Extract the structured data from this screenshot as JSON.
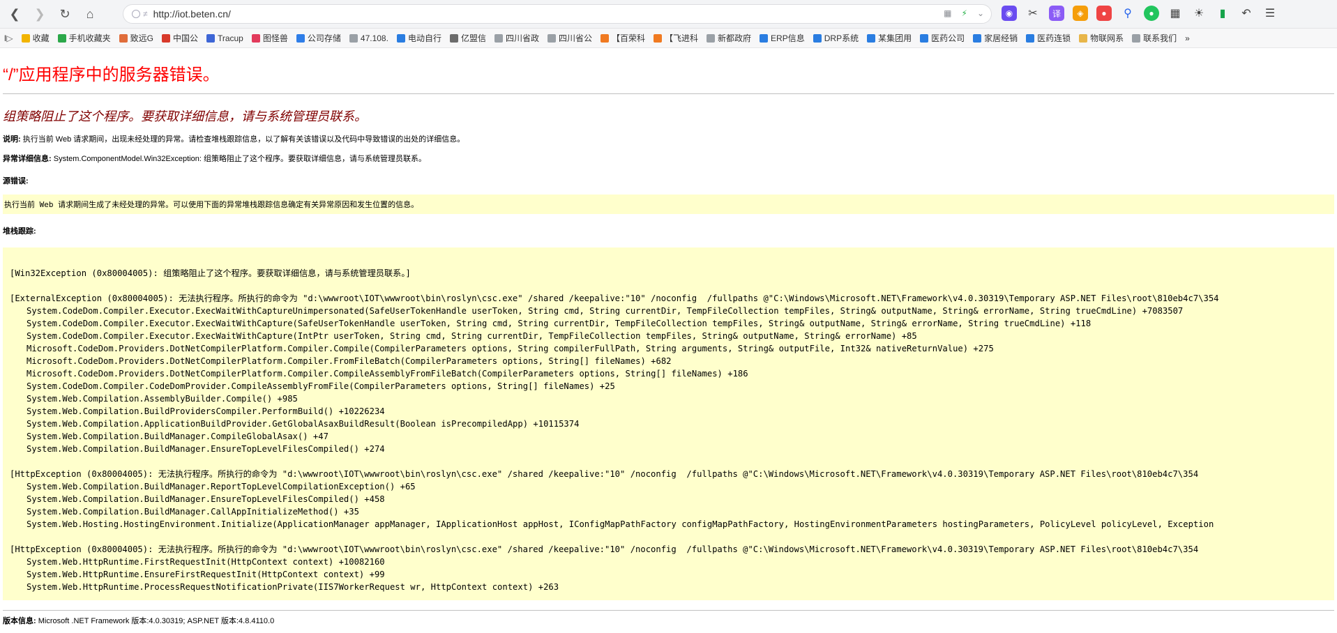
{
  "browser": {
    "url_scheme": "http://",
    "url_host": "iot.beten.cn/",
    "bookmarks": [
      {
        "label": "收藏",
        "color": "#f2b400"
      },
      {
        "label": "手机收藏夹",
        "color": "#2ca84a"
      },
      {
        "label": "致远G",
        "color": "#e06d3b"
      },
      {
        "label": "中国公",
        "color": "#d83a2b"
      },
      {
        "label": "Tracup",
        "color": "#3e66d6"
      },
      {
        "label": "图怪兽",
        "color": "#e23b5c"
      },
      {
        "label": "公司存储",
        "color": "#2f7ee8"
      },
      {
        "label": "47.108.",
        "color": "#9aa0a6"
      },
      {
        "label": "电动自行",
        "color": "#2a7de1"
      },
      {
        "label": "亿盟信",
        "color": "#6c6c6c"
      },
      {
        "label": "四川省政",
        "color": "#9aa0a6"
      },
      {
        "label": "四川省公",
        "color": "#9aa0a6"
      },
      {
        "label": "【百荣科",
        "color": "#f07a21"
      },
      {
        "label": "【飞进科",
        "color": "#f07a21"
      },
      {
        "label": "新都政府",
        "color": "#9aa0a6"
      },
      {
        "label": "ERP信息",
        "color": "#2a7de1"
      },
      {
        "label": "DRP系统",
        "color": "#2a7de1"
      },
      {
        "label": "某集团用",
        "color": "#2a7de1"
      },
      {
        "label": "医药公司",
        "color": "#2a7de1"
      },
      {
        "label": "家居经销",
        "color": "#2a7de1"
      },
      {
        "label": "医药连锁",
        "color": "#2a7de1"
      },
      {
        "label": "物联网系",
        "color": "#e8b64a"
      },
      {
        "label": "联系我们",
        "color": "#9aa0a6"
      }
    ],
    "more_label": "»"
  },
  "page": {
    "title": "“/”应用程序中的服务器错误。",
    "subtitle": "组策略阻止了这个程序。要获取详细信息，请与系统管理员联系。",
    "desc_label": "说明:",
    "desc_text": " 执行当前 Web 请求期间，出现未经处理的异常。请检查堆栈跟踪信息，以了解有关该错误以及代码中导致错误的出处的详细信息。",
    "exception_label": "异常详细信息:",
    "exception_text": " System.ComponentModel.Win32Exception: 组策略阻止了这个程序。要获取详细信息，请与系统管理员联系。",
    "source_label": "源错误:",
    "source_text": "执行当前 Web 请求期间生成了未经处理的异常。可以使用下面的异常堆栈跟踪信息确定有关异常原因和发生位置的信息。",
    "stack_label": "堆栈跟踪:",
    "stack_lines": [
      {
        "text": "[Win32Exception (0x80004005): 组策略阻止了这个程序。要获取详细信息，请与系统管理员联系。]",
        "indent": false,
        "gap": true
      },
      {
        "text": "[ExternalException (0x80004005): 无法执行程序。所执行的命令为 \"d:\\wwwroot\\IOT\\wwwroot\\bin\\roslyn\\csc.exe\" /shared /keepalive:\"10\" /noconfig  /fullpaths @\"C:\\Windows\\Microsoft.NET\\Framework\\v4.0.30319\\Temporary ASP.NET Files\\root\\810eb4c7\\354",
        "indent": false,
        "gap": true
      },
      {
        "text": "System.CodeDom.Compiler.Executor.ExecWaitWithCaptureUnimpersonated(SafeUserTokenHandle userToken, String cmd, String currentDir, TempFileCollection tempFiles, String& outputName, String& errorName, String trueCmdLine) +7083507",
        "indent": true,
        "gap": false
      },
      {
        "text": "System.CodeDom.Compiler.Executor.ExecWaitWithCapture(SafeUserTokenHandle userToken, String cmd, String currentDir, TempFileCollection tempFiles, String& outputName, String& errorName, String trueCmdLine) +118",
        "indent": true,
        "gap": false
      },
      {
        "text": "System.CodeDom.Compiler.Executor.ExecWaitWithCapture(IntPtr userToken, String cmd, String currentDir, TempFileCollection tempFiles, String& outputName, String& errorName) +85",
        "indent": true,
        "gap": false
      },
      {
        "text": "Microsoft.CodeDom.Providers.DotNetCompilerPlatform.Compiler.Compile(CompilerParameters options, String compilerFullPath, String arguments, String& outputFile, Int32& nativeReturnValue) +275",
        "indent": true,
        "gap": false
      },
      {
        "text": "Microsoft.CodeDom.Providers.DotNetCompilerPlatform.Compiler.FromFileBatch(CompilerParameters options, String[] fileNames) +682",
        "indent": true,
        "gap": false
      },
      {
        "text": "Microsoft.CodeDom.Providers.DotNetCompilerPlatform.Compiler.CompileAssemblyFromFileBatch(CompilerParameters options, String[] fileNames) +186",
        "indent": true,
        "gap": false
      },
      {
        "text": "System.CodeDom.Compiler.CodeDomProvider.CompileAssemblyFromFile(CompilerParameters options, String[] fileNames) +25",
        "indent": true,
        "gap": false
      },
      {
        "text": "System.Web.Compilation.AssemblyBuilder.Compile() +985",
        "indent": true,
        "gap": false
      },
      {
        "text": "System.Web.Compilation.BuildProvidersCompiler.PerformBuild() +10226234",
        "indent": true,
        "gap": false
      },
      {
        "text": "System.Web.Compilation.ApplicationBuildProvider.GetGlobalAsaxBuildResult(Boolean isPrecompiledApp) +10115374",
        "indent": true,
        "gap": false
      },
      {
        "text": "System.Web.Compilation.BuildManager.CompileGlobalAsax() +47",
        "indent": true,
        "gap": false
      },
      {
        "text": "System.Web.Compilation.BuildManager.EnsureTopLevelFilesCompiled() +274",
        "indent": true,
        "gap": false
      },
      {
        "text": "[HttpException (0x80004005): 无法执行程序。所执行的命令为 \"d:\\wwwroot\\IOT\\wwwroot\\bin\\roslyn\\csc.exe\" /shared /keepalive:\"10\" /noconfig  /fullpaths @\"C:\\Windows\\Microsoft.NET\\Framework\\v4.0.30319\\Temporary ASP.NET Files\\root\\810eb4c7\\354",
        "indent": false,
        "gap": true
      },
      {
        "text": "System.Web.Compilation.BuildManager.ReportTopLevelCompilationException() +65",
        "indent": true,
        "gap": false
      },
      {
        "text": "System.Web.Compilation.BuildManager.EnsureTopLevelFilesCompiled() +458",
        "indent": true,
        "gap": false
      },
      {
        "text": "System.Web.Compilation.BuildManager.CallAppInitializeMethod() +35",
        "indent": true,
        "gap": false
      },
      {
        "text": "System.Web.Hosting.HostingEnvironment.Initialize(ApplicationManager appManager, IApplicationHost appHost, IConfigMapPathFactory configMapPathFactory, HostingEnvironmentParameters hostingParameters, PolicyLevel policyLevel, Exception",
        "indent": true,
        "gap": false
      },
      {
        "text": "[HttpException (0x80004005): 无法执行程序。所执行的命令为 \"d:\\wwwroot\\IOT\\wwwroot\\bin\\roslyn\\csc.exe\" /shared /keepalive:\"10\" /noconfig  /fullpaths @\"C:\\Windows\\Microsoft.NET\\Framework\\v4.0.30319\\Temporary ASP.NET Files\\root\\810eb4c7\\354",
        "indent": false,
        "gap": true
      },
      {
        "text": "System.Web.HttpRuntime.FirstRequestInit(HttpContext context) +10082160",
        "indent": true,
        "gap": false
      },
      {
        "text": "System.Web.HttpRuntime.EnsureFirstRequestInit(HttpContext context) +99",
        "indent": true,
        "gap": false
      },
      {
        "text": "System.Web.HttpRuntime.ProcessRequestNotificationPrivate(IIS7WorkerRequest wr, HttpContext context) +263",
        "indent": true,
        "gap": false
      }
    ],
    "version_label": "版本信息:",
    "version_text": " Microsoft .NET Framework 版本:4.0.30319; ASP.NET 版本:4.8.4110.0"
  }
}
